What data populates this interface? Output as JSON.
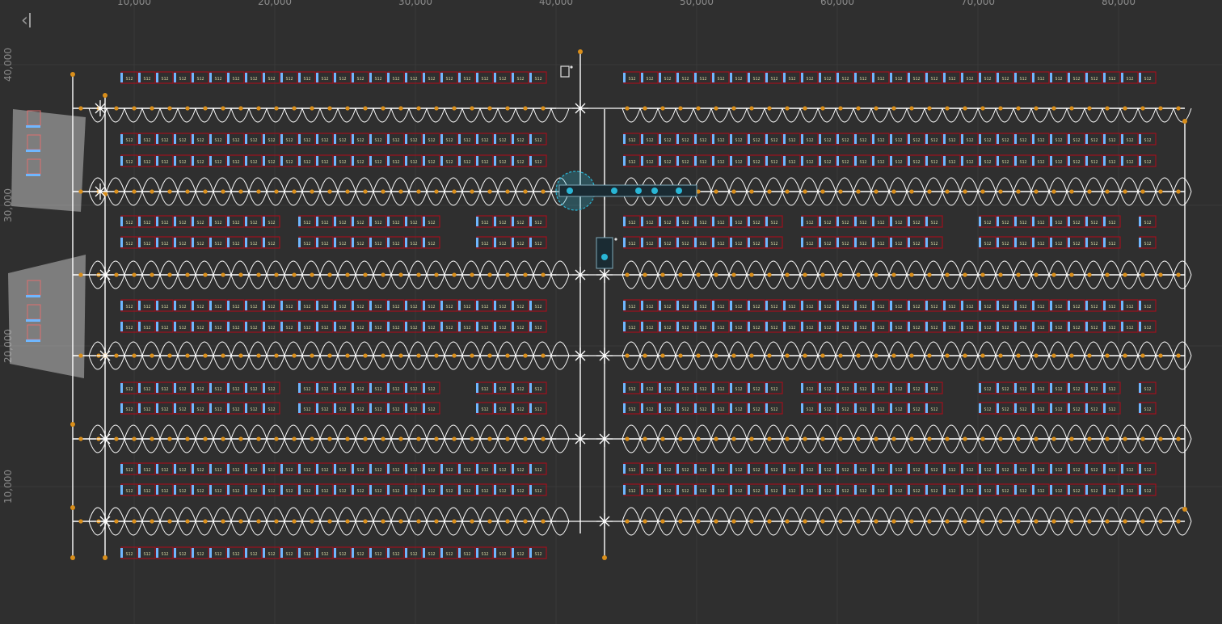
{
  "toolbar": {
    "collapse_icon": "collapse-left-icon"
  },
  "axes": {
    "x_ticks": [
      "10,000",
      "20,000",
      "30,000",
      "40,000",
      "50,000",
      "60,000",
      "70,000",
      "80,000"
    ],
    "y_ticks": [
      "40,000",
      "30,000",
      "20,000",
      "10,000"
    ]
  },
  "station_label": "S12",
  "colors": {
    "background": "#2f2f2f",
    "grid": "#3a3a3a",
    "path": "#ffffff",
    "node": "#d98e1a",
    "shelf_border": "#a0101e",
    "shelf_marker": "#6fb7ff",
    "station_area": "#bdbdbd",
    "robot": "#1f5f7a",
    "robot_ring": "#29b6d6"
  },
  "icons": [
    "charger-icon",
    "robot-icon",
    "station-area-icon",
    "collapse-left-icon"
  ]
}
